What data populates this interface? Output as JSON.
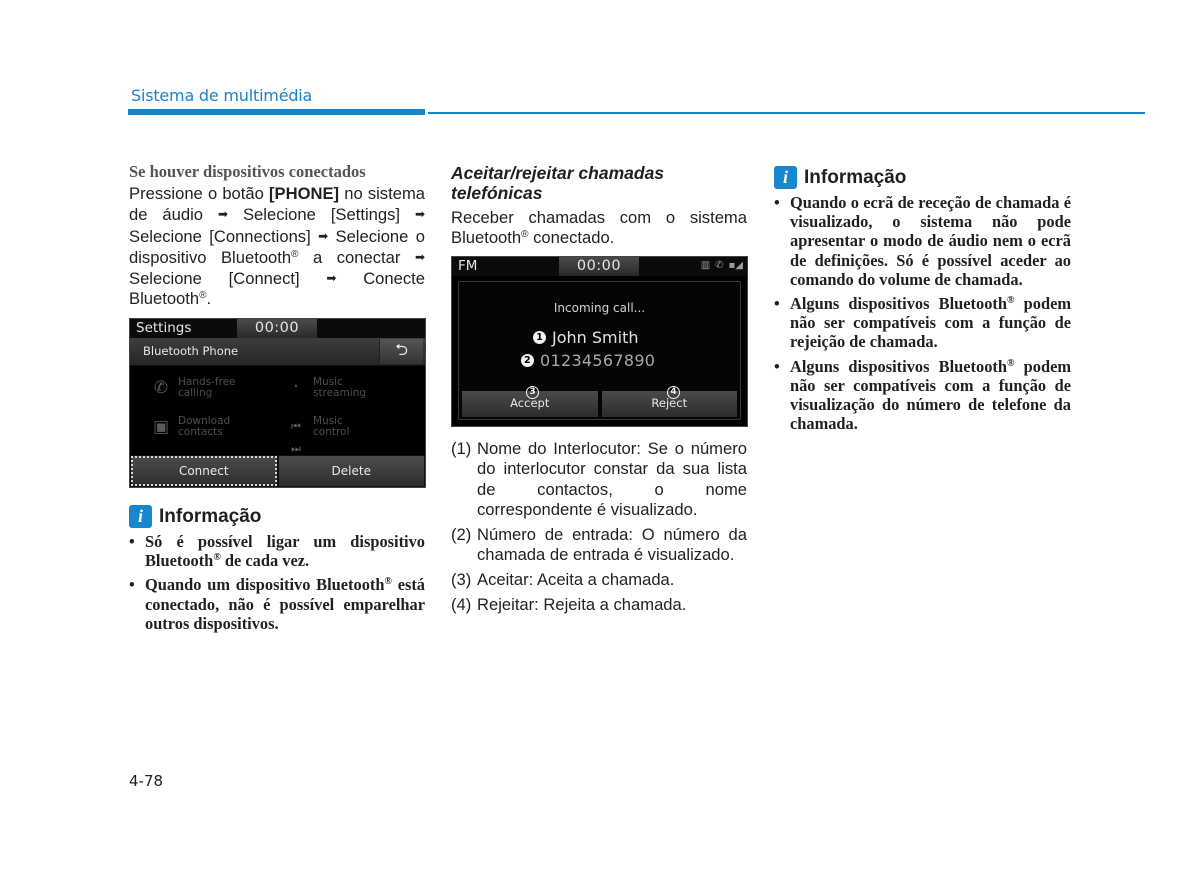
{
  "header": {
    "section_title": "Sistema de multimédia",
    "accent_color": "#1585c7"
  },
  "col1": {
    "subheading": "Se houver dispositivos conectados",
    "paragraph": {
      "t1": "Pressione o botão ",
      "phone_key": "[PHONE]",
      "t2": " no sistema de áudio ",
      "t3": " Selecione [Settings] ",
      "t4": " Selecione [Connections] ",
      "t5": " Selecione o dispositivo Bluetooth",
      "t6": " a conectar ",
      "t7": " Selecione [Connect] ",
      "t8": " Conecte Bluetooth",
      "t9": ".",
      "arrow": "➡",
      "reg": "®"
    },
    "screen": {
      "status_label": "Settings",
      "time": "00:00",
      "title": "Bluetooth Phone",
      "back_icon": "return-arrow",
      "features": [
        {
          "icon": "handsfree-phone-icon",
          "line1": "Hands-free",
          "line2": "calling"
        },
        {
          "icon": "bluetooth-music-icon",
          "line1": "Music",
          "line2": "streaming"
        },
        {
          "icon": "contacts-book-icon",
          "line1": "Download",
          "line2": "contacts"
        },
        {
          "icon": "prev-next-track-icon",
          "line1": "Music",
          "line2": "control"
        }
      ],
      "buttons": [
        {
          "label": "Connect",
          "focused": true
        },
        {
          "label": "Delete",
          "focused": false
        }
      ]
    },
    "info": {
      "title": "Informação",
      "bullets": [
        {
          "a": "Só é possível ligar um dispositivo Bluetooth",
          "b": " de cada vez."
        },
        {
          "a": "Quando um dispositivo Bluetooth",
          "b": " está conectado, não é possível emparelhar outros dispositivos."
        }
      ]
    }
  },
  "col2": {
    "heading": "Aceitar/rejeitar chamadas telefónicas",
    "intro_a": "Receber chamadas com o sistema Bluetooth",
    "intro_b": " conectado.",
    "screen": {
      "status_label": "FM",
      "time": "00:00",
      "status_icons": [
        "battery-icon",
        "phone-icon",
        "signal-icon"
      ],
      "incoming_text": "Incoming call...",
      "caller_name": "John Smith",
      "caller_number": "01234567890",
      "markers": [
        "1",
        "2",
        "3",
        "4"
      ],
      "buttons": [
        "Accept",
        "Reject"
      ]
    },
    "legend": [
      {
        "n": "(1)",
        "text": "Nome do Interlocutor: Se o número do interlocutor constar da sua lista de contactos, o nome correspondente é visualizado."
      },
      {
        "n": "(2)",
        "text": "Número de entrada: O número da chamada de entrada é visualizado."
      },
      {
        "n": "(3)",
        "text": "Aceitar: Aceita  a chamada."
      },
      {
        "n": "(4)",
        "text": "Rejeitar: Rejeita a chamada."
      }
    ]
  },
  "col3": {
    "info": {
      "title": "Informação",
      "bullets": [
        {
          "a": "Quando o ecrã de receção de chamada é visualizado, o sistema não pode apresentar o modo de áudio nem o ecrã de definições. Só é possível aceder ao comando do volume de chamada.",
          "b": ""
        },
        {
          "a": "Alguns dispositivos Bluetooth",
          "b": " podem não ser compatíveis com a função de rejeição de chamada."
        },
        {
          "a": "Alguns dispositivos Bluetooth",
          "b": " podem não ser compatíveis com a função de visualização do número de telefone da chamada."
        }
      ]
    }
  },
  "footer": {
    "page_number": "4-78"
  }
}
